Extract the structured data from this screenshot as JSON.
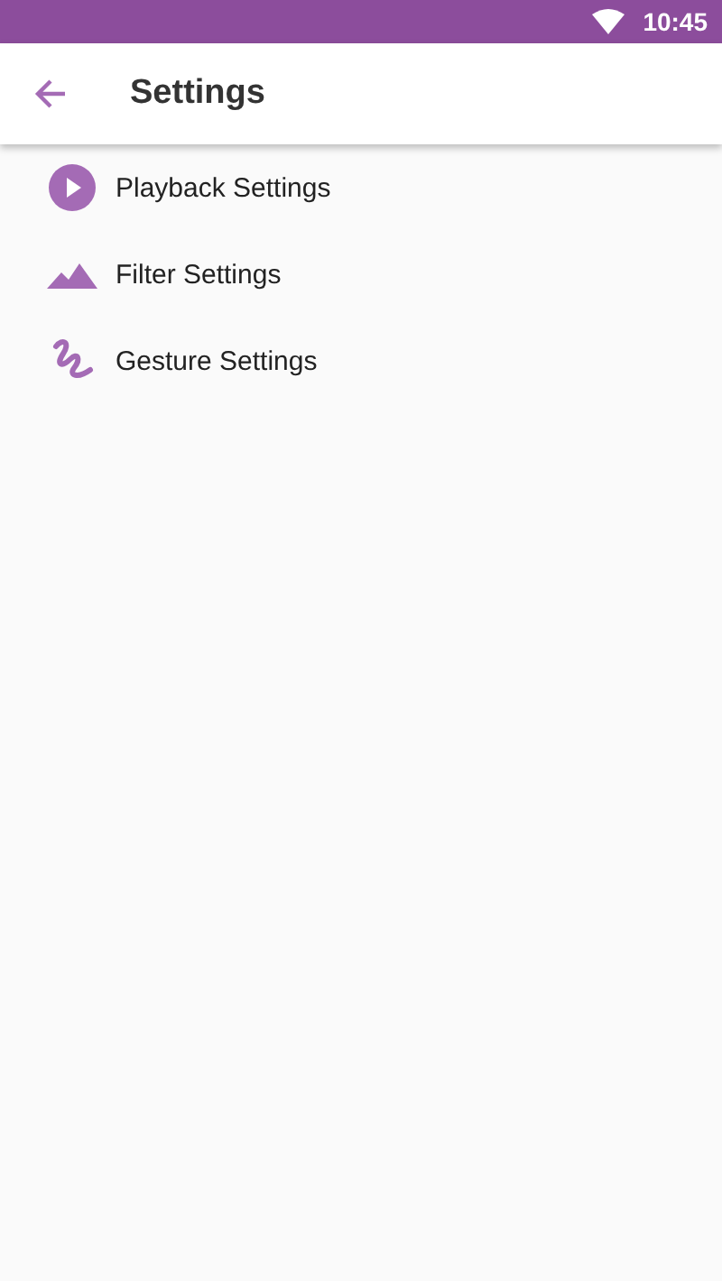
{
  "status_bar": {
    "time": "10:45"
  },
  "app_bar": {
    "title": "Settings"
  },
  "items": [
    {
      "kind": "playback",
      "label": "Playback Settings"
    },
    {
      "kind": "filter",
      "label": "Filter Settings"
    },
    {
      "kind": "gesture",
      "label": "Gesture Settings"
    }
  ]
}
